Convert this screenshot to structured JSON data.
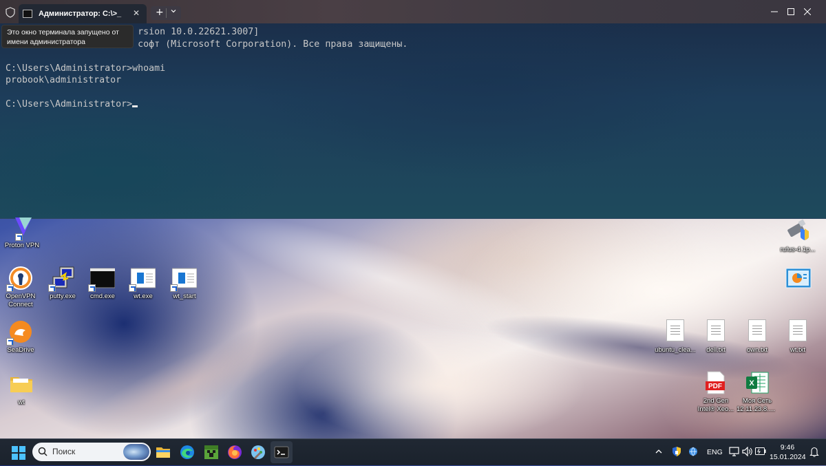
{
  "terminal": {
    "tab_title": "Администратор: C:\\>_",
    "tooltip": "Это окно терминала запущено от имени администратора",
    "lines": [
      "                        rsion 10.0.22621.3007]",
      "                        софт (Microsoft Corporation). Все права защищены.",
      "",
      "C:\\Users\\Administrator>whoami",
      "probook\\administrator",
      "",
      "C:\\Users\\Administrator>"
    ]
  },
  "desktop": {
    "icons_left": [
      {
        "label": "Proton VPN",
        "icon": "protonvpn-icon"
      },
      {
        "label": "OpenVPN Connect",
        "icon": "openvpn-icon"
      },
      {
        "label": "putty.exe",
        "icon": "putty-icon"
      },
      {
        "label": "cmd.exe",
        "icon": "cmd-icon"
      },
      {
        "label": "wt.exe",
        "icon": "wt-icon"
      },
      {
        "label": "wt_start",
        "icon": "wt-start-icon"
      },
      {
        "label": "SeaDrive",
        "icon": "seadrive-icon"
      },
      {
        "label": "wt",
        "icon": "folder-icon"
      }
    ],
    "icons_right": [
      {
        "label": "rufus-4.1p...",
        "icon": "rufus-icon"
      },
      {
        "label": "",
        "icon": "control-panel-icon"
      },
      {
        "label": "ubuntu_clea...",
        "icon": "text-file-icon"
      },
      {
        "label": "dell.txt",
        "icon": "text-file-icon"
      },
      {
        "label": "own.txt",
        "icon": "text-file-icon"
      },
      {
        "label": "wt.txt",
        "icon": "text-file-icon"
      },
      {
        "label": "2nd Gen Intel® Xeo...",
        "icon": "pdf-icon"
      },
      {
        "label": "Моя Сеть 12.11.23.8.xlsx",
        "icon": "excel-icon"
      }
    ]
  },
  "taskbar": {
    "search_placeholder": "Поиск",
    "apps": [
      "file-explorer-icon",
      "edge-icon",
      "minecraft-icon",
      "firefox-icon",
      "paint-icon",
      "terminal-icon"
    ],
    "language": "ENG",
    "time": "9:46",
    "date": "15.01.2024"
  },
  "colors": {
    "terminal_bg": "#1d3d5a",
    "taskbar_bg": "#1f2937",
    "accent": "#8ab4f8"
  }
}
